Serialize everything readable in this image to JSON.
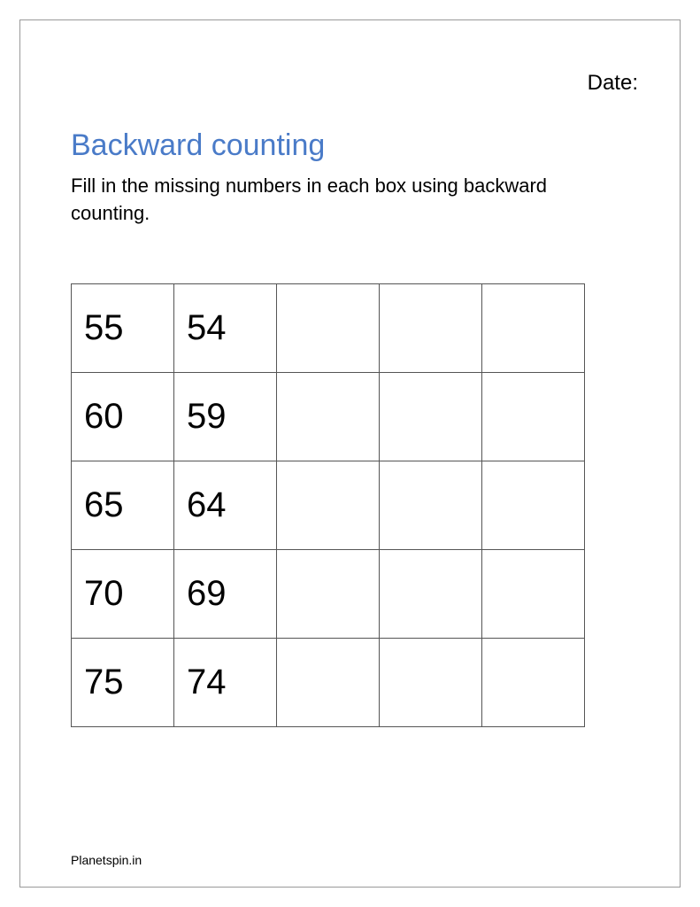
{
  "date_label": "Date:",
  "title": "Backward counting",
  "instructions": "Fill in the missing numbers in each box using backward counting.",
  "grid": {
    "rows": [
      [
        "55",
        "54",
        "",
        "",
        ""
      ],
      [
        "60",
        "59",
        "",
        "",
        ""
      ],
      [
        "65",
        "64",
        "",
        "",
        ""
      ],
      [
        "70",
        "69",
        "",
        "",
        ""
      ],
      [
        "75",
        "74",
        "",
        "",
        ""
      ]
    ]
  },
  "footer": "Planetspin.in"
}
